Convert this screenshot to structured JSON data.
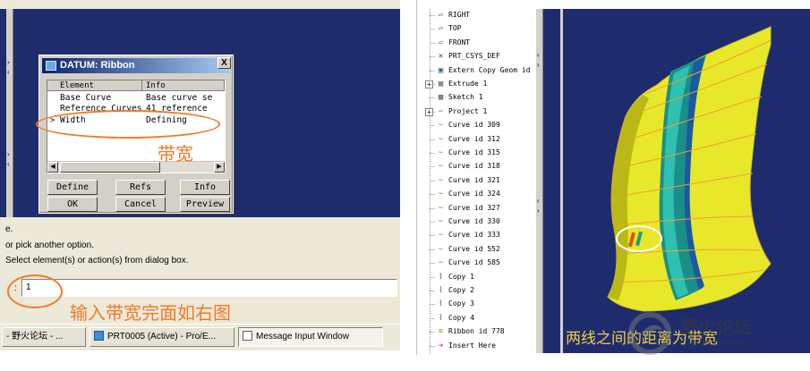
{
  "dialog": {
    "title": "DATUM: Ribbon",
    "close_glyph": "X",
    "columns": [
      "Element",
      "Info"
    ],
    "rows": [
      {
        "element": "Base Curve",
        "info": "Base curve se"
      },
      {
        "element": "Reference Curves",
        "info": "41 reference"
      },
      {
        "element": "Width",
        "info": "Defining",
        "marker": ">"
      }
    ],
    "buttons": {
      "define": "Define",
      "refs": "Refs",
      "info": "Info",
      "ok": "OK",
      "cancel": "Cancel",
      "preview": "Preview"
    }
  },
  "annotations": {
    "width_label": "带宽",
    "input_hint": "输入带宽完面如右图",
    "right_caption": "两线之间的距离为带宽"
  },
  "messages": [
    "e.",
    "or pick another option.",
    "Select element(s) or action(s) from dialog box."
  ],
  "input": {
    "prefix": ":",
    "value": "1"
  },
  "taskbar": [
    {
      "label": "- 野火论坛 - ...",
      "icon_color": "#2f62c8",
      "icon": "browser-icon"
    },
    {
      "label": "PRT0005 (Active) - Pro/E...",
      "icon_color": "#3a8fd0",
      "icon": "proe-icon"
    },
    {
      "label": "Message Input Window",
      "icon_color": "#f3f3f3",
      "icon": "window-icon",
      "active": true
    }
  ],
  "tree": {
    "items": [
      {
        "icon": "datum-plane-icon",
        "glyph": "▱",
        "label": "RIGHT"
      },
      {
        "icon": "datum-plane-icon",
        "glyph": "▱",
        "label": "TOP"
      },
      {
        "icon": "datum-plane-icon",
        "glyph": "▱",
        "label": "FRONT"
      },
      {
        "icon": "csys-icon",
        "glyph": "✕",
        "label": "PRT_CSYS_DEF"
      },
      {
        "icon": "copy-geom-icon",
        "glyph": "▣",
        "label": "Extern Copy Geom id"
      },
      {
        "icon": "extrude-icon",
        "glyph": "▦",
        "label": "Extrude 1",
        "expand": "+"
      },
      {
        "icon": "sketch-icon",
        "glyph": "▩",
        "label": "Sketch 1"
      },
      {
        "icon": "project-icon",
        "glyph": "∽",
        "label": "Project 1",
        "expand": "+"
      },
      {
        "icon": "curve-icon",
        "glyph": "∼",
        "label": "Curve id 309"
      },
      {
        "icon": "curve-icon",
        "glyph": "∼",
        "label": "Curve id 312"
      },
      {
        "icon": "curve-icon",
        "glyph": "∼",
        "label": "Curve id 315"
      },
      {
        "icon": "curve-icon",
        "glyph": "∼",
        "label": "Curve id 318"
      },
      {
        "icon": "curve-icon",
        "glyph": "∼",
        "label": "Curve id 321"
      },
      {
        "icon": "curve-icon",
        "glyph": "∼",
        "label": "Curve id 324"
      },
      {
        "icon": "curve-icon",
        "glyph": "∼",
        "label": "Curve id 327"
      },
      {
        "icon": "curve-icon",
        "glyph": "∼",
        "label": "Curve id 330"
      },
      {
        "icon": "curve-icon",
        "glyph": "∼",
        "label": "Curve id 333"
      },
      {
        "icon": "curve-icon",
        "glyph": "∼",
        "label": "Curve id 552"
      },
      {
        "icon": "curve-icon",
        "glyph": "∼",
        "label": "Curve id 585"
      },
      {
        "icon": "copy-icon",
        "glyph": "⌇",
        "label": "Copy 1"
      },
      {
        "icon": "copy-icon",
        "glyph": "⌇",
        "label": "Copy 2"
      },
      {
        "icon": "copy-icon",
        "glyph": "⌇",
        "label": "Copy 3"
      },
      {
        "icon": "copy-icon",
        "glyph": "⌇",
        "label": "Copy 4"
      },
      {
        "icon": "ribbon-icon",
        "glyph": "≋",
        "label": "Ribbon id 778"
      },
      {
        "icon": "insert-here-icon",
        "glyph": "➔",
        "label": "Insert Here"
      }
    ]
  },
  "watermark": {
    "title": "野火论坛",
    "url": "www.proewildfire.cn"
  },
  "colors": {
    "viewport_bg": "#1e2c6e",
    "surface_yellow": "#e8e82a",
    "ribbon_teal": "#1a8f8a",
    "annotation_orange": "#f07a2a",
    "caption_yellow": "#f0cc40"
  }
}
